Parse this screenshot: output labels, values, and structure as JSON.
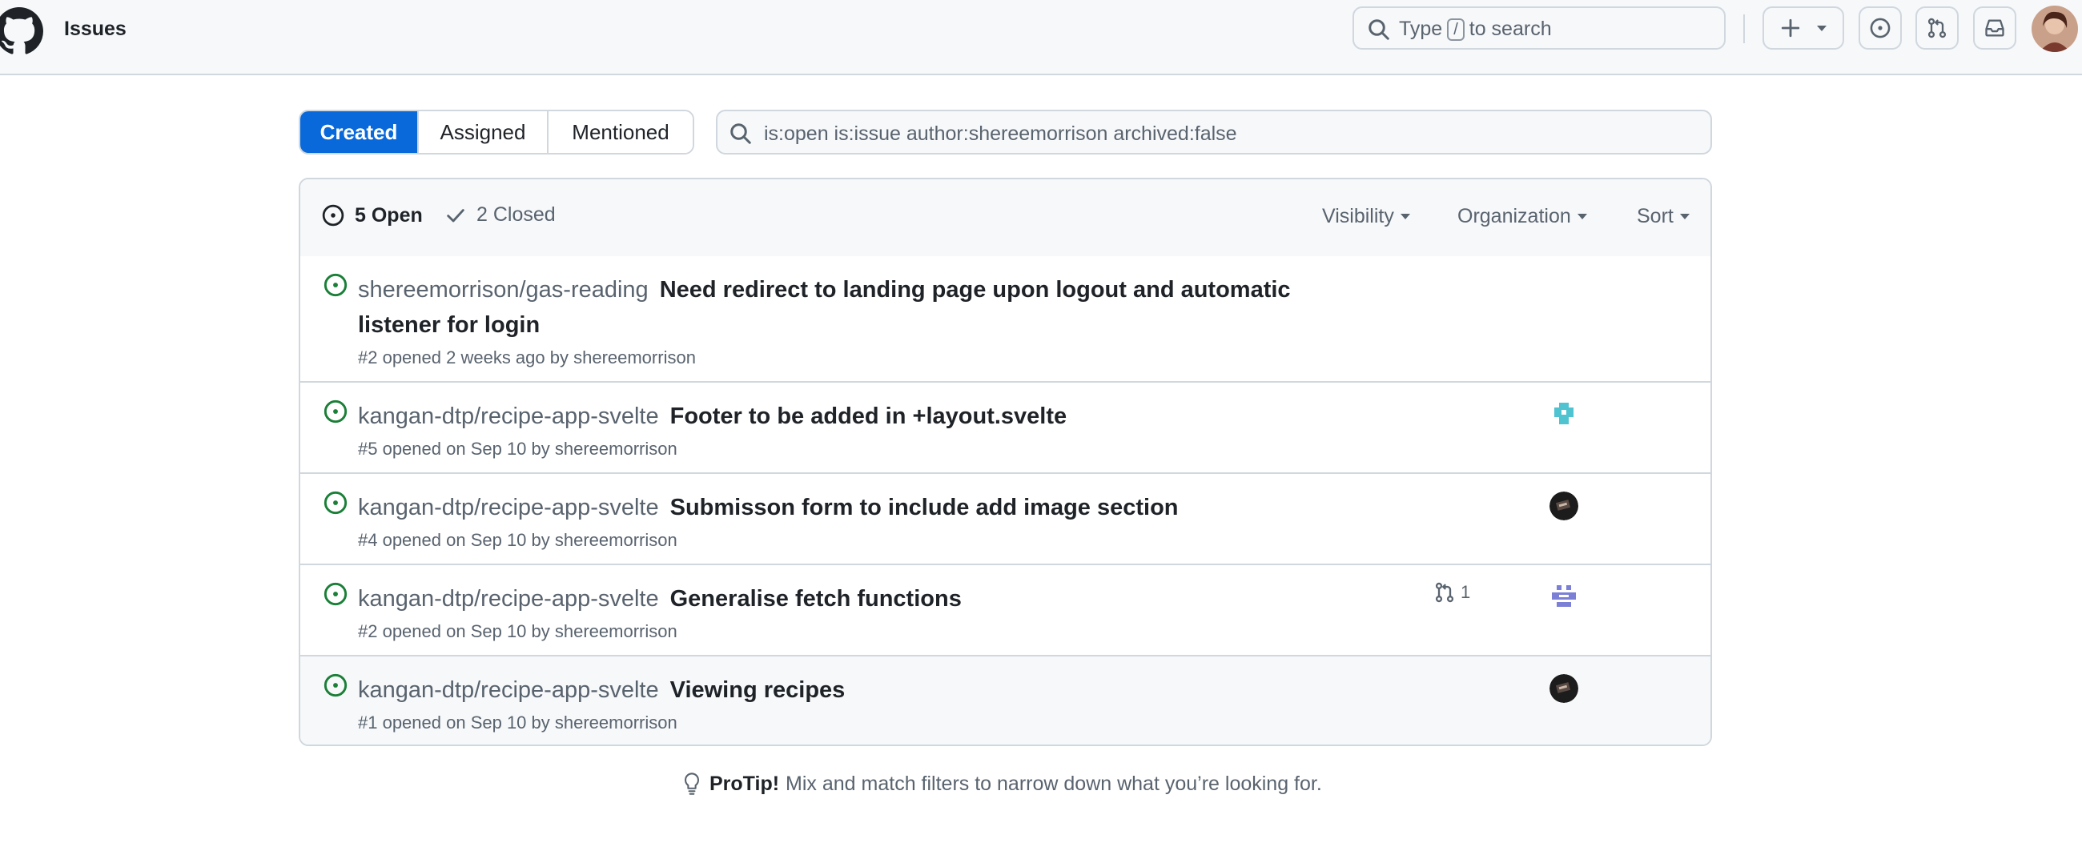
{
  "header": {
    "title": "Issues",
    "search": {
      "prefix": "Type",
      "key": "/",
      "suffix": "to search"
    }
  },
  "filters": {
    "tabs": [
      {
        "label": "Created",
        "active": true
      },
      {
        "label": "Assigned",
        "active": false
      },
      {
        "label": "Mentioned",
        "active": false
      }
    ],
    "query": "is:open is:issue author:shereemorrison archived:false"
  },
  "list": {
    "open_label": "5 Open",
    "closed_label": "2 Closed",
    "visibility_label": "Visibility",
    "organization_label": "Organization",
    "sort_label": "Sort"
  },
  "issues": [
    {
      "repo": "shereemorrison/gas-reading",
      "title": "Need redirect to landing page upon logout and automatic listener for login",
      "meta": "#2 opened 2 weeks ago by shereemorrison"
    },
    {
      "repo": "kangan-dtp/recipe-app-svelte",
      "title": "Footer to be added in +layout.svelte",
      "meta": "#5 opened on Sep 10 by shereemorrison"
    },
    {
      "repo": "kangan-dtp/recipe-app-svelte",
      "title": "Submisson form to include add image section",
      "meta": "#4 opened on Sep 10 by shereemorrison"
    },
    {
      "repo": "kangan-dtp/recipe-app-svelte",
      "title": "Generalise fetch functions",
      "meta": "#2 opened on Sep 10 by shereemorrison",
      "linked_prs": "1"
    },
    {
      "repo": "kangan-dtp/recipe-app-svelte",
      "title": "Viewing recipes",
      "meta": "#1 opened on Sep 10 by shereemorrison"
    }
  ],
  "protip": {
    "label": "ProTip!",
    "text": "Mix and match filters to narrow down what you’re looking for."
  },
  "colors": {
    "accent": "#0969da",
    "open": "#1a7f37",
    "muted": "#59636e",
    "border": "#d0d7de"
  }
}
